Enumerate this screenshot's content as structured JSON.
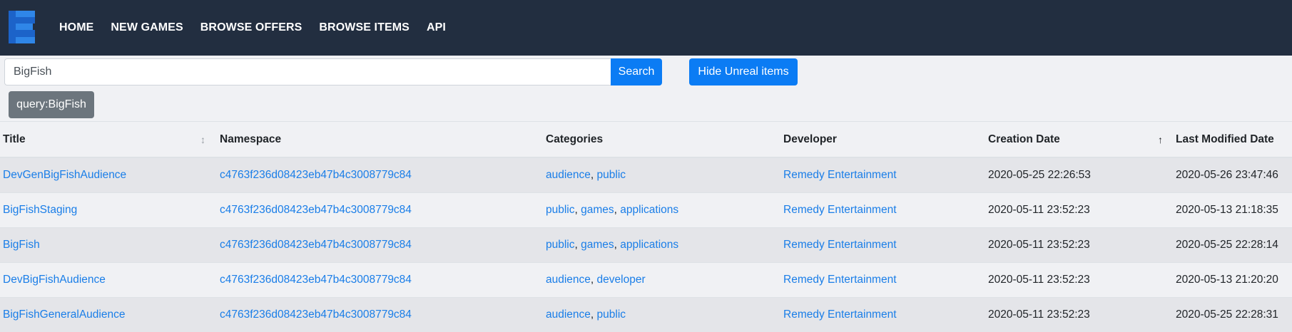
{
  "nav": {
    "logo_icon": "epic-e-logo-icon",
    "links": [
      "HOME",
      "NEW GAMES",
      "BROWSE OFFERS",
      "BROWSE ITEMS",
      "API"
    ]
  },
  "search": {
    "value": "BigFish",
    "button_label": "Search"
  },
  "toolbar": {
    "hide_unreal_label": "Hide Unreal items"
  },
  "filters": {
    "query_tag": "query:BigFish"
  },
  "table": {
    "headers": {
      "title": "Title",
      "namespace": "Namespace",
      "categories": "Categories",
      "developer": "Developer",
      "creation_date": "Creation Date",
      "last_modified": "Last Modified Date"
    },
    "sort_indicators": {
      "title": "↕",
      "creation_date": "↑"
    },
    "rows": [
      {
        "title": "DevGenBigFishAudience",
        "namespace": "c4763f236d08423eb47b4c3008779c84",
        "categories": [
          "audience",
          "public"
        ],
        "developer": "Remedy Entertainment",
        "creation_date": "2020-05-25 22:26:53",
        "last_modified": "2020-05-26 23:47:46"
      },
      {
        "title": "BigFishStaging",
        "namespace": "c4763f236d08423eb47b4c3008779c84",
        "categories": [
          "public",
          "games",
          "applications"
        ],
        "developer": "Remedy Entertainment",
        "creation_date": "2020-05-11 23:52:23",
        "last_modified": "2020-05-13 21:18:35"
      },
      {
        "title": "BigFish",
        "namespace": "c4763f236d08423eb47b4c3008779c84",
        "categories": [
          "public",
          "games",
          "applications"
        ],
        "developer": "Remedy Entertainment",
        "creation_date": "2020-05-11 23:52:23",
        "last_modified": "2020-05-25 22:28:14"
      },
      {
        "title": "DevBigFishAudience",
        "namespace": "c4763f236d08423eb47b4c3008779c84",
        "categories": [
          "audience",
          "developer"
        ],
        "developer": "Remedy Entertainment",
        "creation_date": "2020-05-11 23:52:23",
        "last_modified": "2020-05-13 21:20:20"
      },
      {
        "title": "BigFishGeneralAudience",
        "namespace": "c4763f236d08423eb47b4c3008779c84",
        "categories": [
          "audience",
          "public"
        ],
        "developer": "Remedy Entertainment",
        "creation_date": "2020-05-11 23:52:23",
        "last_modified": "2020-05-25 22:28:31"
      }
    ]
  },
  "colors": {
    "navbar_bg": "#222e40",
    "primary": "#0b7cf4",
    "secondary": "#6c757d",
    "link": "#1a7ee8"
  }
}
